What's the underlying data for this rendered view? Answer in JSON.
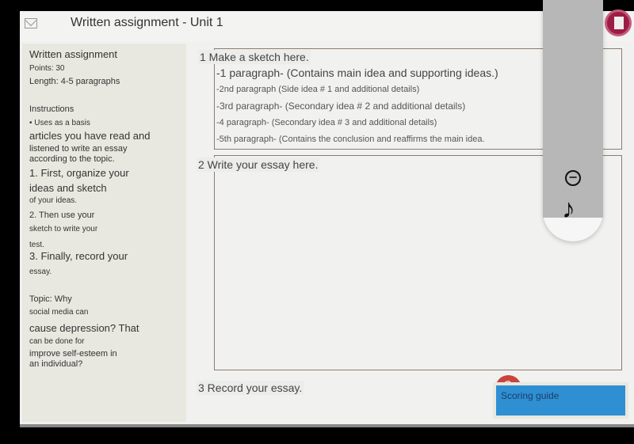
{
  "header": {
    "title": "Written assignment - Unit 1"
  },
  "sidebar": {
    "heading": "Written assignment",
    "points": "Points: 30",
    "length": "Length: 4-5 paragraphs",
    "instructions_heading": "Instructions",
    "instructions": [
      "• Uses as a basis",
      "articles you have read and",
      "listened to write an essay",
      "according to the topic.",
      "1. First, organize your",
      "ideas and sketch",
      "of your ideas.",
      "2. Then use your",
      "sketch to write your",
      "test.",
      "3. Finally, record your",
      "essay."
    ],
    "topic": [
      "Topic: Why",
      "social media can",
      "cause depression? That",
      "can be done for",
      "improve self-esteem in",
      "an individual?"
    ]
  },
  "main": {
    "sketch_label": "1 Make a sketch here.",
    "sketch_lines": [
      "-1 paragraph- (Contains main idea and supporting ideas.)",
      "-2nd paragraph (Side idea # 1 and additional details)",
      "-3rd paragraph- (Secondary idea # 2 and additional details)",
      "-4 paragraph- (Secondary idea # 3 and additional details)",
      "-5th paragraph- (Contains the conclusion and reaffirms the main idea."
    ],
    "essay_label": "2 Write your essay here.",
    "essay_value": "",
    "record_label": "3 Record your essay.",
    "scoring_guide": "Scoring guide"
  },
  "colors": {
    "accent": "#2f8fd3",
    "mic": "#c9443a",
    "doc_button": "#9b1d45"
  }
}
